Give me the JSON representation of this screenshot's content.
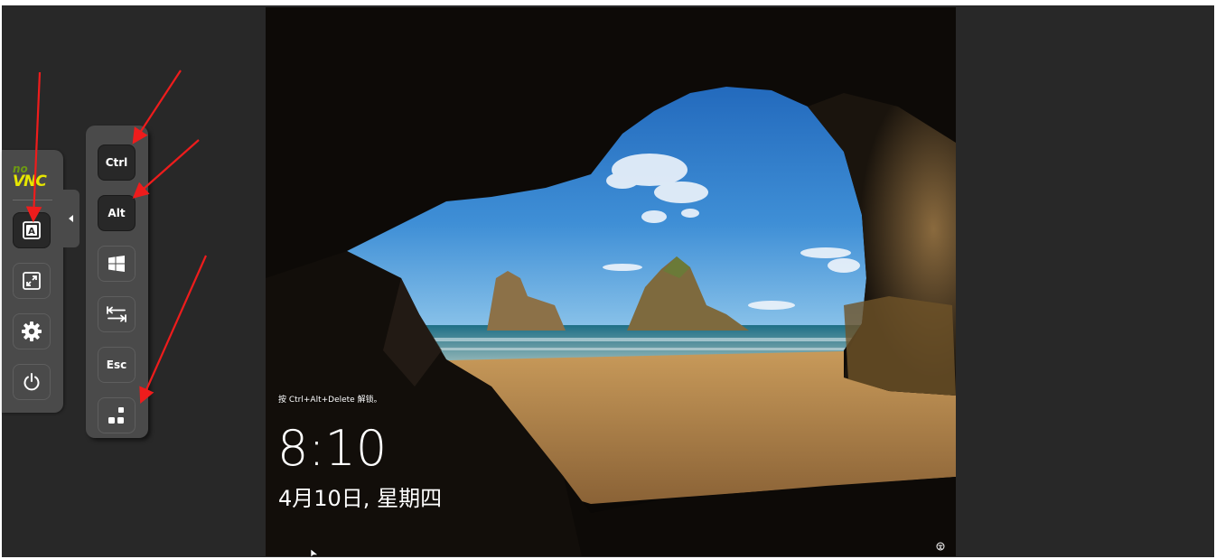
{
  "lock_screen": {
    "hint": "按 Ctrl+Alt+Delete 解锁。",
    "time": "8:10",
    "date": "4月10日, 星期四"
  },
  "control_bar": {
    "logo_top": "no",
    "logo_bottom": "VNC",
    "buttons": [
      {
        "name": "extra-keys-button",
        "icon": "keyboard-a-icon",
        "selected": true
      },
      {
        "name": "fullscreen-button",
        "icon": "fullscreen-icon",
        "selected": false
      },
      {
        "name": "settings-button",
        "icon": "gear-icon",
        "selected": false
      },
      {
        "name": "power-button",
        "icon": "power-icon",
        "selected": false
      }
    ]
  },
  "extra_keys": {
    "ctrl_label": "Ctrl",
    "alt_label": "Alt",
    "windows_icon": "windows-icon",
    "tab_icon": "tab-icon",
    "esc_label": "Esc",
    "ctrl_alt_del_icon": "ctrl-alt-del-icon"
  },
  "colors": {
    "viewport_bg": "#282828",
    "panel_bg": "#4a4a4a",
    "logo_no": "#6d9a12",
    "logo_vnc": "#e6e600",
    "annotation_arrow": "#ee1c1c",
    "sky": "#2f78c4",
    "sand": "#b08752"
  }
}
